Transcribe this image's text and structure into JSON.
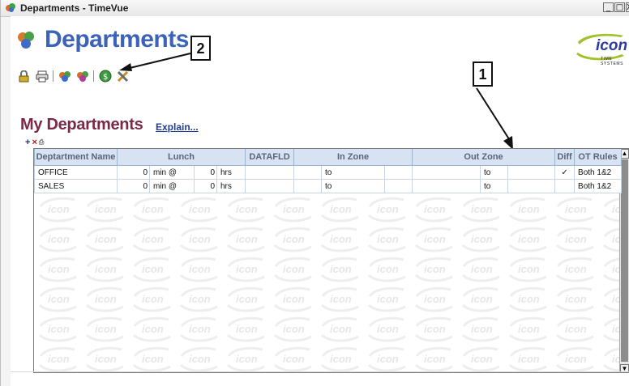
{
  "window": {
    "title": "Departments - TimeVue",
    "controls": [
      "_",
      "□",
      "X"
    ]
  },
  "header": {
    "title": "Departments",
    "logo_text": "icon",
    "logo_subtext": "TIME SYSTEMS"
  },
  "callouts": [
    "2",
    "1"
  ],
  "toolbar": {
    "buttons": [
      "lock-icon",
      "printer-icon",
      "department-icon",
      "department-add-icon",
      "money-icon",
      "tools-icon"
    ]
  },
  "section": {
    "title": "My Departments",
    "explain_link": "Explain..."
  },
  "mini_tools": [
    "+",
    "×",
    "⎙"
  ],
  "table": {
    "headers": [
      "Deptartment Name",
      "Lunch",
      "DATAFLD",
      "In Zone",
      "Out Zone",
      "Diff",
      "OT Rules"
    ],
    "rows": [
      {
        "name": "OFFICE",
        "lunch_min": "0",
        "min_label": "min @",
        "lunch_hrs": "0",
        "hrs_label": "hrs",
        "datafld": "",
        "in_zone_left": "",
        "in_zone_to": "to",
        "in_zone_right": "",
        "out_zone_left": "",
        "out_zone_to": "to",
        "out_zone_right": "",
        "diff": "✓",
        "ot_rules": "Both 1&2"
      },
      {
        "name": "SALES",
        "lunch_min": "0",
        "min_label": "min @",
        "lunch_hrs": "0",
        "hrs_label": "hrs",
        "datafld": "",
        "in_zone_left": "",
        "in_zone_to": "to",
        "in_zone_right": "",
        "out_zone_left": "",
        "out_zone_to": "to",
        "out_zone_right": "",
        "diff": "",
        "ot_rules": "Both 1&2"
      }
    ]
  },
  "watermark": {
    "text": "icon"
  }
}
